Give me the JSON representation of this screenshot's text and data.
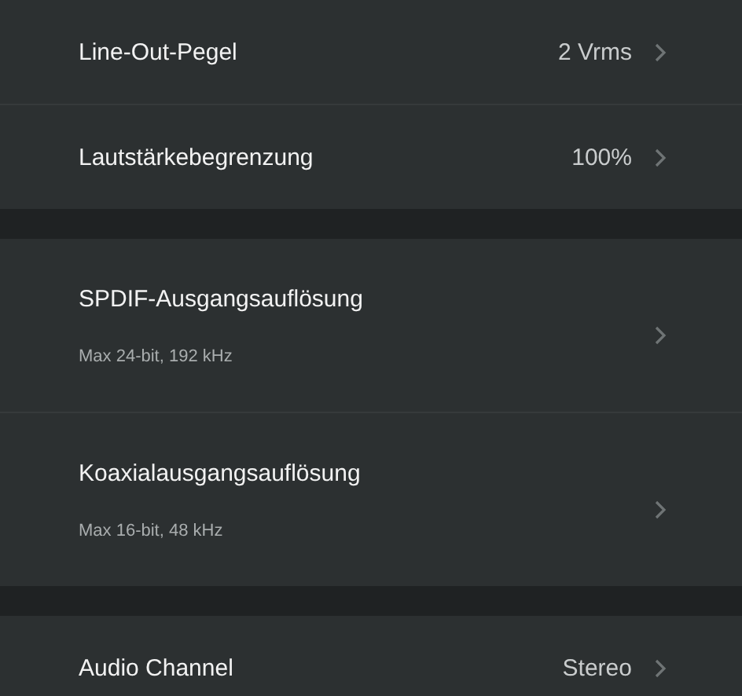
{
  "groups": [
    {
      "items": [
        {
          "kind": "value",
          "label": "Line-Out-Pegel",
          "value": "2 Vrms"
        },
        {
          "kind": "value",
          "label": "Lautstärkebegrenzung",
          "value": "100%"
        }
      ]
    },
    {
      "items": [
        {
          "kind": "detail",
          "label": "SPDIF-Ausgangsauflösung",
          "subtitle": "Max 24-bit, 192 kHz"
        },
        {
          "kind": "detail",
          "label": "Koaxialausgangsauflösung",
          "subtitle": "Max 16-bit, 48 kHz"
        }
      ]
    },
    {
      "items": [
        {
          "kind": "value",
          "label": "Audio Channel",
          "value": "Stereo"
        }
      ]
    }
  ]
}
